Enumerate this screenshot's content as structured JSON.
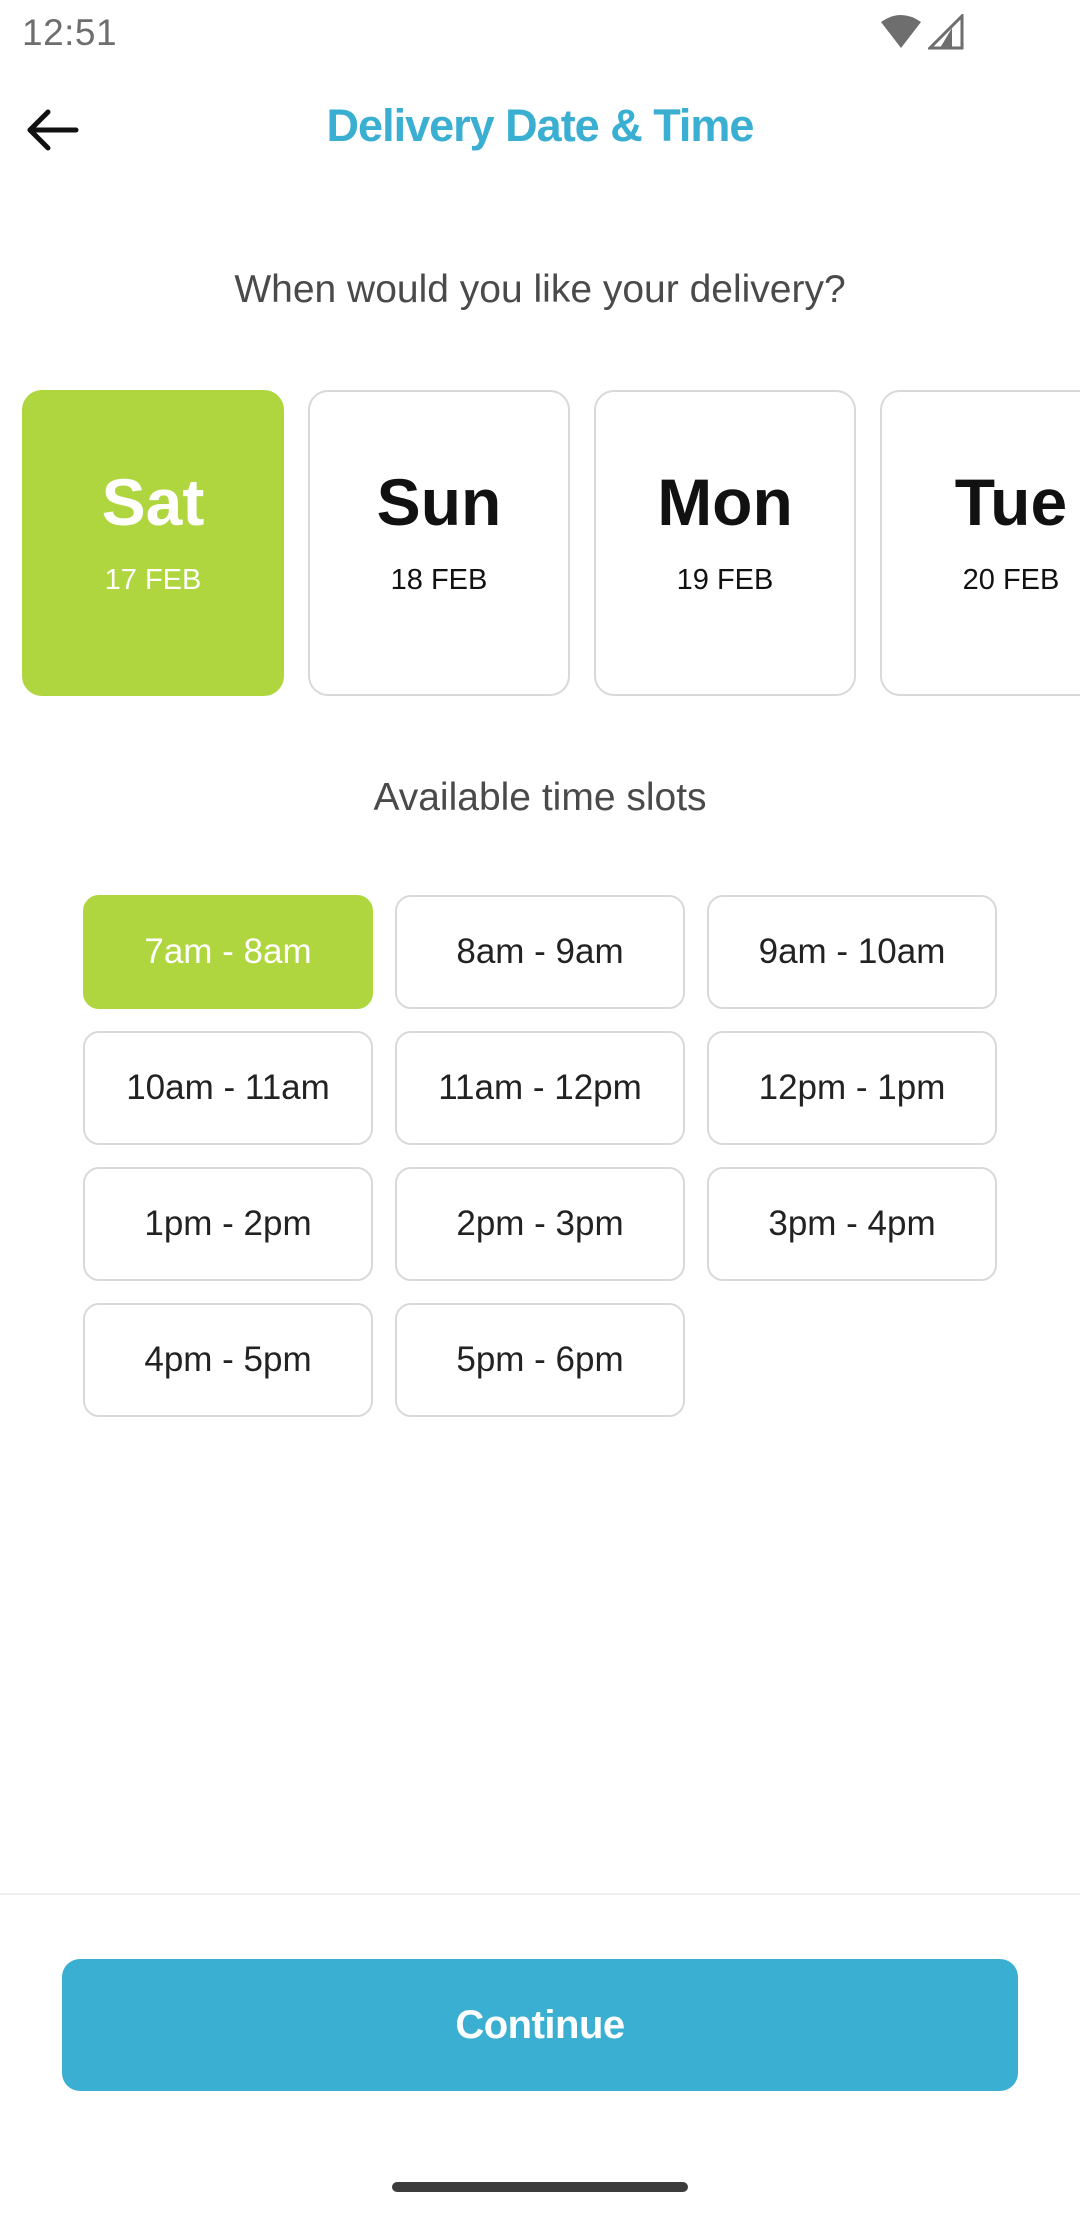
{
  "status_bar": {
    "time": "12:51",
    "icons": [
      "wifi-icon",
      "signal-icon"
    ]
  },
  "header": {
    "back_icon": "arrow-left-icon",
    "title": "Delivery Date & Time"
  },
  "question": "When would you like your delivery?",
  "dates": [
    {
      "day": "Sat",
      "date": "17 FEB",
      "selected": true
    },
    {
      "day": "Sun",
      "date": "18 FEB",
      "selected": false
    },
    {
      "day": "Mon",
      "date": "19 FEB",
      "selected": false
    },
    {
      "day": "Tue",
      "date": "20 FEB",
      "selected": false
    }
  ],
  "slots_heading": "Available time slots",
  "time_slots": [
    {
      "label": "7am - 8am",
      "selected": true
    },
    {
      "label": "8am - 9am",
      "selected": false
    },
    {
      "label": "9am - 10am",
      "selected": false
    },
    {
      "label": "10am - 11am",
      "selected": false
    },
    {
      "label": "11am - 12pm",
      "selected": false
    },
    {
      "label": "12pm - 1pm",
      "selected": false
    },
    {
      "label": "1pm - 2pm",
      "selected": false
    },
    {
      "label": "2pm - 3pm",
      "selected": false
    },
    {
      "label": "3pm - 4pm",
      "selected": false
    },
    {
      "label": "4pm - 5pm",
      "selected": false
    },
    {
      "label": "5pm - 6pm",
      "selected": false
    }
  ],
  "continue_label": "Continue",
  "colors": {
    "accent_green": "#afd63f",
    "accent_blue": "#3aafd2"
  }
}
